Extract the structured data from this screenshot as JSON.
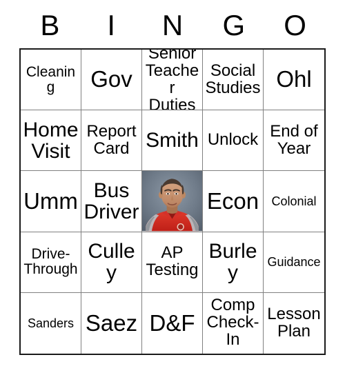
{
  "card": {
    "header_letters": [
      "B",
      "I",
      "N",
      "G",
      "O"
    ],
    "rows": [
      [
        {
          "text": "Cleaning",
          "size": "sm"
        },
        {
          "text": "Gov",
          "size": "xl"
        },
        {
          "text": "Senior Teacher Duties",
          "size": "md"
        },
        {
          "text": "Social Studies",
          "size": "md"
        },
        {
          "text": "Ohl",
          "size": "xl"
        }
      ],
      [
        {
          "text": "Home Visit",
          "size": "lg"
        },
        {
          "text": "Report Card",
          "size": "md"
        },
        {
          "text": "Smith",
          "size": "lg"
        },
        {
          "text": "Unlock",
          "size": "md"
        },
        {
          "text": "End of Year",
          "size": "md"
        }
      ],
      [
        {
          "text": "Umm",
          "size": "xl"
        },
        {
          "text": "Bus Driver",
          "size": "lg"
        },
        {
          "text": "",
          "size": "md",
          "type": "photo",
          "photo_label": "teacher-portrait-free-space"
        },
        {
          "text": "Econ",
          "size": "xl"
        },
        {
          "text": "Colonial",
          "size": "xs"
        }
      ],
      [
        {
          "text": "Drive-Through",
          "size": "sm"
        },
        {
          "text": "Culley",
          "size": "lg"
        },
        {
          "text": "AP Testing",
          "size": "md"
        },
        {
          "text": "Burley",
          "size": "lg"
        },
        {
          "text": "Guidance",
          "size": "xs"
        }
      ],
      [
        {
          "text": "Sanders",
          "size": "xs"
        },
        {
          "text": "Saez",
          "size": "xl"
        },
        {
          "text": "D&F",
          "size": "xl"
        },
        {
          "text": "Comp Check-In",
          "size": "md"
        },
        {
          "text": "Lesson Plan",
          "size": "md"
        }
      ]
    ]
  },
  "colors": {
    "outer_border": "#1a1a1a",
    "inner_border": "#808080",
    "cell_background": "#ffffff",
    "text": "#000000",
    "photo_backdrop": "#6b7684",
    "photo_shirt": "#d32a22",
    "photo_skin": "#c9926f"
  }
}
